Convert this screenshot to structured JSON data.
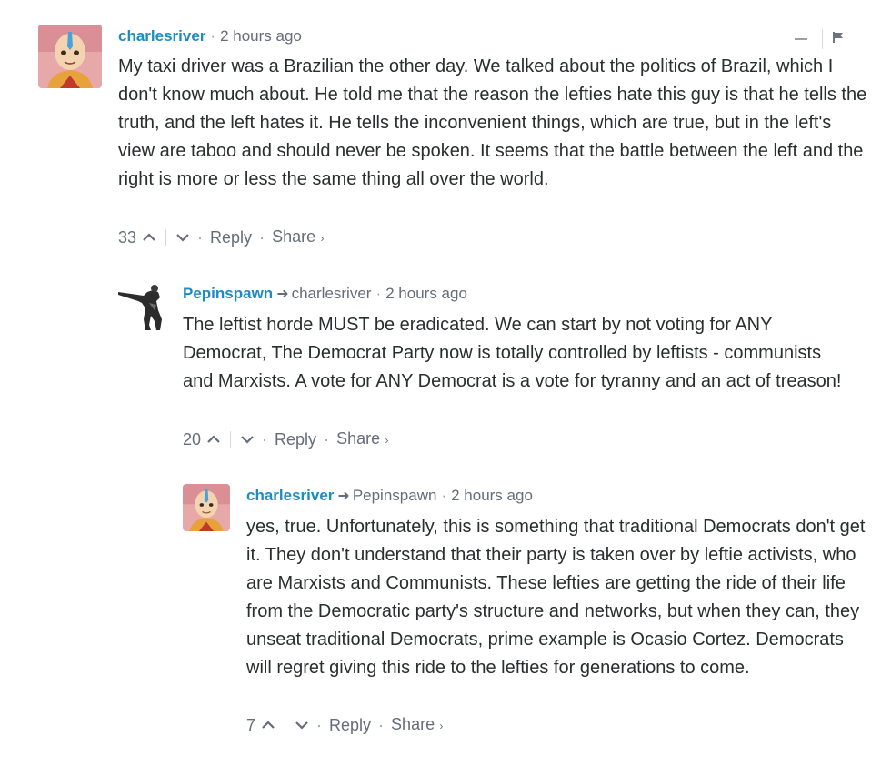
{
  "comments": [
    {
      "author": "charlesriver",
      "reply_to": "",
      "time": "2 hours ago",
      "text": "My taxi driver was a Brazilian the other day. We talked about the politics of Brazil, which I don't know much about. He told me that the reason the lefties hate this guy is that he tells the truth, and the left hates it. He tells the inconvenient things, which are true, but in the left's view are taboo and should never be spoken. It seems that the battle between the left and the right is more or less the same thing all over the world.",
      "votes": "33",
      "reply_label": "Reply",
      "share_label": "Share",
      "avatar_icon": "aang-avatar"
    },
    {
      "author": "Pepinspawn",
      "reply_to": "charlesriver",
      "time": "2 hours ago",
      "text": "The leftist horde MUST be eradicated. We can start by not voting for ANY Democrat, The Democrat Party now is totally controlled by leftists - communists and Marxists. A vote for ANY Democrat is a vote for tyranny and an act of treason!",
      "votes": "20",
      "reply_label": "Reply",
      "share_label": "Share",
      "avatar_icon": "soldier-silhouette-avatar"
    },
    {
      "author": "charlesriver",
      "reply_to": "Pepinspawn",
      "time": "2 hours ago",
      "text": "yes, true. Unfortunately, this is something that traditional Democrats don't get it. They don't understand that their party is taken over by leftie activists, who are Marxists and Communists. These lefties are getting the ride of their life from the Democratic party's structure and networks, but when they can, they unseat traditional Democrats, prime example is Ocasio Cortez. Democrats will regret giving this ride to the lefties for generations to come.",
      "votes": "7",
      "reply_label": "Reply",
      "share_label": "Share",
      "avatar_icon": "aang-avatar"
    }
  ],
  "colors": {
    "author": "#1e8bc3",
    "meta": "#656c7a",
    "text": "#2a2e2e"
  }
}
